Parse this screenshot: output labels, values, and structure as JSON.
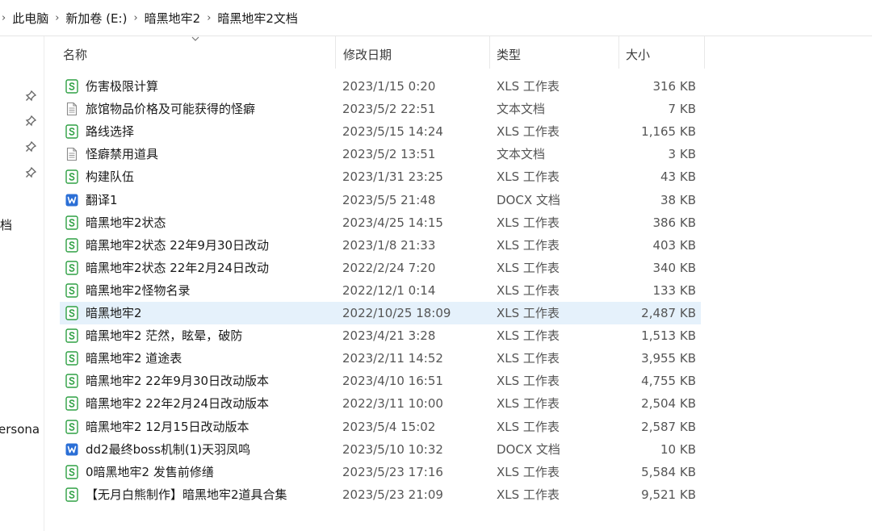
{
  "breadcrumb": {
    "items": [
      "此电脑",
      "新加卷 (E:)",
      "暗黑地牢2",
      "暗黑地牢2文档"
    ]
  },
  "nav": {
    "partial_labels": [
      "档",
      "ersona"
    ]
  },
  "columns": {
    "name": "名称",
    "date": "修改日期",
    "type": "类型",
    "size": "大小"
  },
  "colors": {
    "selected_row": "#e5f1fb",
    "xls_icon": "#2ea043",
    "docx_icon": "#2b6fd6",
    "txt_icon": "#8a8a8a"
  },
  "files": [
    {
      "name": "伤害极限计算",
      "date": "2023/1/15 0:20",
      "type": "XLS 工作表",
      "size": "316 KB",
      "icon": "xls-icon"
    },
    {
      "name": "旅馆物品价格及可能获得的怪癖",
      "date": "2023/5/2 22:51",
      "type": "文本文档",
      "size": "7 KB",
      "icon": "txt-icon"
    },
    {
      "name": "路线选择",
      "date": "2023/5/15 14:24",
      "type": "XLS 工作表",
      "size": "1,165 KB",
      "icon": "xls-icon"
    },
    {
      "name": "怪癖禁用道具",
      "date": "2023/5/2 13:51",
      "type": "文本文档",
      "size": "3 KB",
      "icon": "txt-icon"
    },
    {
      "name": "构建队伍",
      "date": "2023/1/31 23:25",
      "type": "XLS 工作表",
      "size": "43 KB",
      "icon": "xls-icon"
    },
    {
      "name": "翻译1",
      "date": "2023/5/5 21:48",
      "type": "DOCX 文档",
      "size": "38 KB",
      "icon": "docx-icon"
    },
    {
      "name": "暗黑地牢2状态",
      "date": "2023/4/25 14:15",
      "type": "XLS 工作表",
      "size": "386 KB",
      "icon": "xls-icon"
    },
    {
      "name": "暗黑地牢2状态 22年9月30日改动",
      "date": "2023/1/8 21:33",
      "type": "XLS 工作表",
      "size": "403 KB",
      "icon": "xls-icon"
    },
    {
      "name": "暗黑地牢2状态 22年2月24日改动",
      "date": "2022/2/24 7:20",
      "type": "XLS 工作表",
      "size": "340 KB",
      "icon": "xls-icon"
    },
    {
      "name": "暗黑地牢2怪物名录",
      "date": "2022/12/1 0:14",
      "type": "XLS 工作表",
      "size": "133 KB",
      "icon": "xls-icon"
    },
    {
      "name": "暗黑地牢2",
      "date": "2022/10/25 18:09",
      "type": "XLS 工作表",
      "size": "2,487 KB",
      "icon": "xls-icon",
      "selected": true
    },
    {
      "name": "暗黑地牢2 茫然，眩晕，破防",
      "date": "2023/4/21 3:28",
      "type": "XLS 工作表",
      "size": "1,513 KB",
      "icon": "xls-icon"
    },
    {
      "name": "暗黑地牢2 道途表",
      "date": "2023/2/11 14:52",
      "type": "XLS 工作表",
      "size": "3,955 KB",
      "icon": "xls-icon"
    },
    {
      "name": "暗黑地牢2 22年9月30日改动版本",
      "date": "2023/4/10 16:51",
      "type": "XLS 工作表",
      "size": "4,755 KB",
      "icon": "xls-icon"
    },
    {
      "name": "暗黑地牢2 22年2月24日改动版本",
      "date": "2022/3/11 10:00",
      "type": "XLS 工作表",
      "size": "2,504 KB",
      "icon": "xls-icon"
    },
    {
      "name": "暗黑地牢2 12月15日改动版本",
      "date": "2023/5/4 15:02",
      "type": "XLS 工作表",
      "size": "2,587 KB",
      "icon": "xls-icon"
    },
    {
      "name": "dd2最终boss机制(1)天羽凤鸣",
      "date": "2023/5/10 10:32",
      "type": "DOCX 文档",
      "size": "10 KB",
      "icon": "docx-icon"
    },
    {
      "name": "0暗黑地牢2 发售前修缮",
      "date": "2023/5/23 17:16",
      "type": "XLS 工作表",
      "size": "5,584 KB",
      "icon": "xls-icon"
    },
    {
      "name": "【无月白熊制作】暗黑地牢2道具合集",
      "date": "2023/5/23 21:09",
      "type": "XLS 工作表",
      "size": "9,521 KB",
      "icon": "xls-icon"
    }
  ]
}
